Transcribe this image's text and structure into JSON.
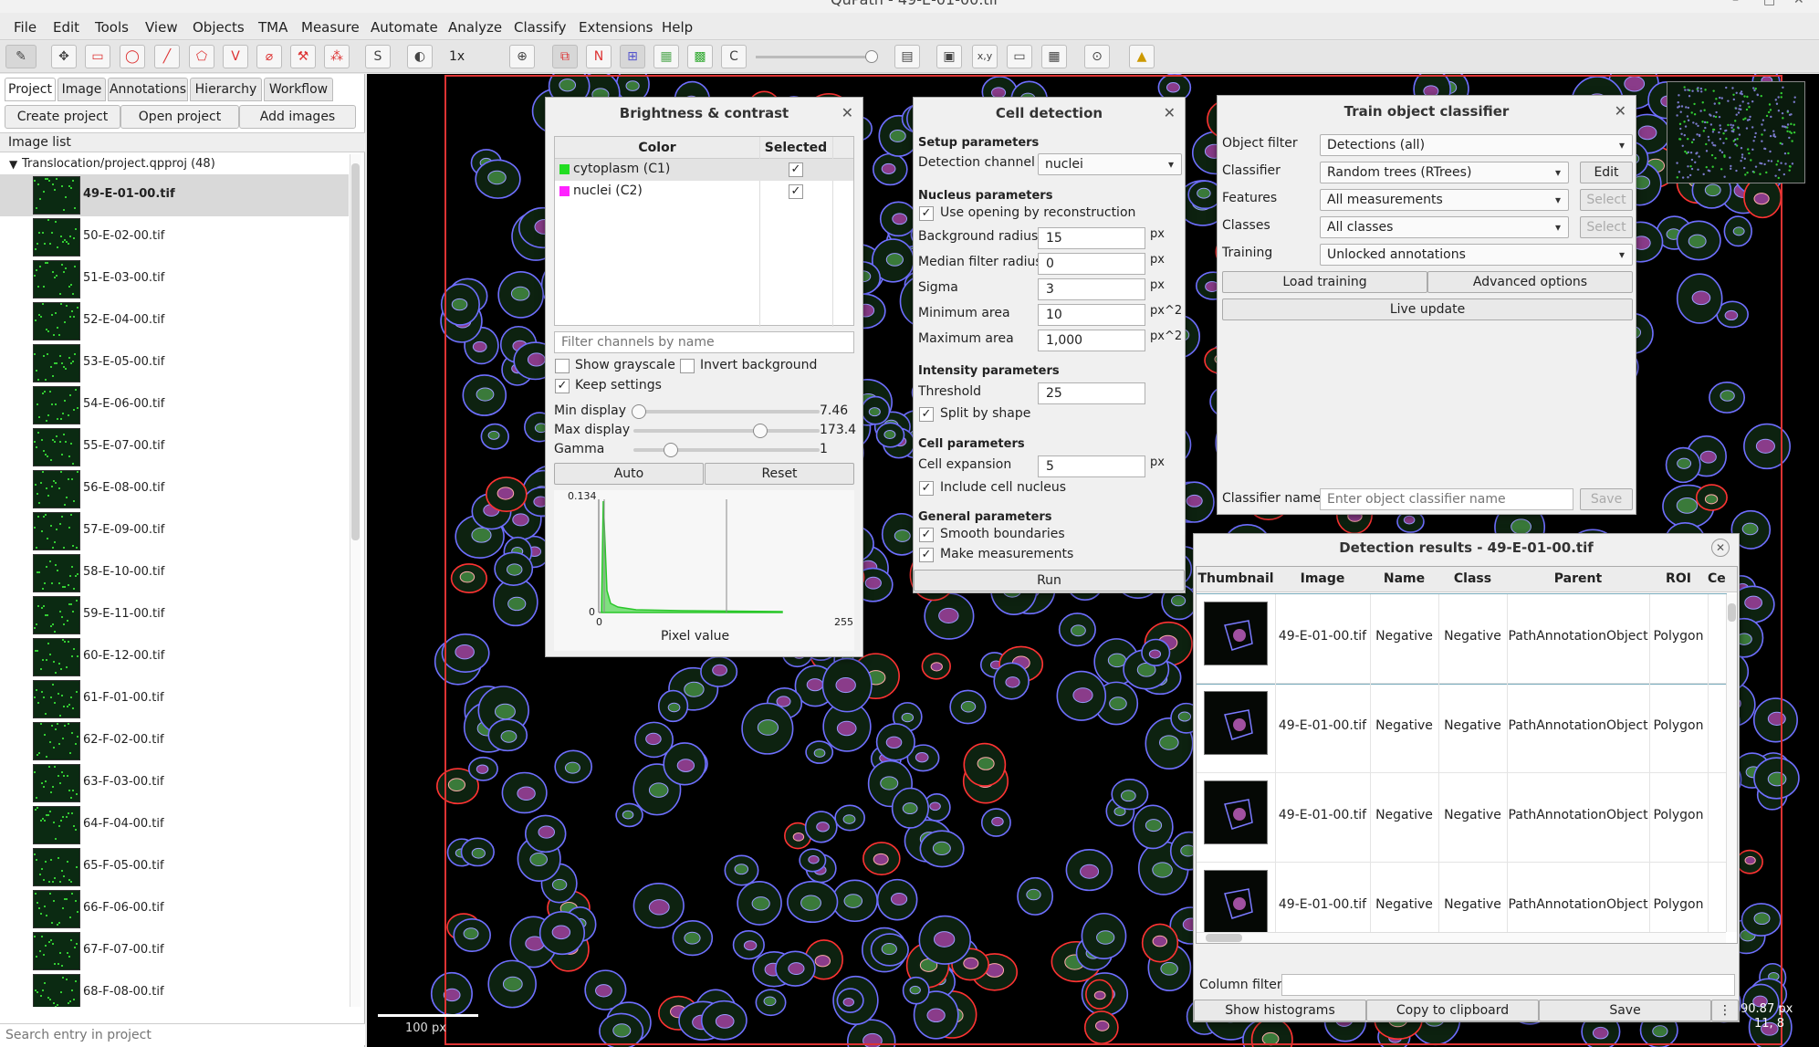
{
  "window_title": "QuPath - 49-E-01-00.tif",
  "menu": [
    "File",
    "Edit",
    "Tools",
    "View",
    "Objects",
    "TMA",
    "Measure",
    "Automate",
    "Analyze",
    "Classify",
    "Extensions",
    "Help"
  ],
  "toolbar": {
    "zoom_label": "1x",
    "s_label": "S",
    "n_label": "N",
    "c_label": "C",
    "xy_label": "x,y"
  },
  "left_panel": {
    "tabs": [
      "Project",
      "Image",
      "Annotations",
      "Hierarchy",
      "Workflow"
    ],
    "buttons": [
      "Create project",
      "Open project",
      "Add images"
    ],
    "image_list_header": "Image list",
    "project_node": "Translocation/project.qpproj (48)",
    "images": [
      "49-E-01-00.tif",
      "50-E-02-00.tif",
      "51-E-03-00.tif",
      "52-E-04-00.tif",
      "53-E-05-00.tif",
      "54-E-06-00.tif",
      "55-E-07-00.tif",
      "56-E-08-00.tif",
      "57-E-09-00.tif",
      "58-E-10-00.tif",
      "59-E-11-00.tif",
      "60-E-12-00.tif",
      "61-F-01-00.tif",
      "62-F-02-00.tif",
      "63-F-03-00.tif",
      "64-F-04-00.tif",
      "65-F-05-00.tif",
      "66-F-06-00.tif",
      "67-F-07-00.tif",
      "68-F-08-00.tif"
    ],
    "search_placeholder": "Search entry in project"
  },
  "viewer": {
    "scale_bar": "100 px",
    "coords_line1": "90.87 px",
    "coords_line2": "11, 8"
  },
  "brightness": {
    "title": "Brightness & contrast",
    "col_color": "Color",
    "col_selected": "Selected",
    "channels": [
      {
        "name": "cytoplasm (C1)",
        "swatch": "#22dd22",
        "selected": "✓"
      },
      {
        "name": "nuclei (C2)",
        "swatch": "#ff22ff",
        "selected": "✓"
      }
    ],
    "filter_placeholder": "Filter channels by name",
    "show_grayscale": "Show grayscale",
    "invert_background": "Invert background",
    "keep_settings": "Keep settings",
    "min_display_label": "Min display",
    "min_display_value": "7.46",
    "min_display_level": 0.03,
    "max_display_label": "Max display",
    "max_display_value": "173.4",
    "max_display_level": 0.68,
    "gamma_label": "Gamma",
    "gamma_value": "1",
    "gamma_level": 0.2,
    "auto": "Auto",
    "reset": "Reset",
    "histogram": {
      "ymax_label": "0.134",
      "y0_label": "0",
      "x0_label": "0",
      "xmax_label": "255",
      "xlabel": "Pixel value"
    }
  },
  "cell_detection": {
    "title": "Cell detection",
    "setup": "Setup parameters",
    "detection_channel_label": "Detection channel",
    "detection_channel_value": "nuclei",
    "nucleus": "Nucleus parameters",
    "use_opening": "Use opening by reconstruction",
    "bg_radius_label": "Background radius",
    "bg_radius": "15",
    "median_label": "Median filter radius",
    "median": "0",
    "sigma_label": "Sigma",
    "sigma": "3",
    "min_area_label": "Minimum area",
    "min_area": "10",
    "max_area_label": "Maximum area",
    "max_area": "1,000",
    "unit_px": "px",
    "unit_px2": "px^2",
    "intensity": "Intensity parameters",
    "threshold_label": "Threshold",
    "threshold": "25",
    "split_by_shape": "Split by shape",
    "cell": "Cell parameters",
    "cell_expansion_label": "Cell expansion",
    "cell_expansion": "5",
    "include_nucleus": "Include cell nucleus",
    "general": "General parameters",
    "smooth": "Smooth boundaries",
    "make_measurements": "Make measurements",
    "run": "Run"
  },
  "classifier": {
    "title": "Train object classifier",
    "object_filter_label": "Object filter",
    "object_filter": "Detections (all)",
    "classifier_label": "Classifier",
    "classifier": "Random trees (RTrees)",
    "edit": "Edit",
    "features_label": "Features",
    "features": "All measurements",
    "select": "Select",
    "classes_label": "Classes",
    "classes": "All classes",
    "training_label": "Training",
    "training": "Unlocked annotations",
    "load_training": "Load training",
    "advanced": "Advanced options",
    "live_update": "Live update",
    "name_label": "Classifier name",
    "name_placeholder": "Enter object classifier name",
    "save": "Save"
  },
  "results": {
    "title": "Detection results - 49-E-01-00.tif",
    "columns": [
      "Thumbnail",
      "Image",
      "Name",
      "Class",
      "Parent",
      "ROI",
      "Ce"
    ],
    "rows": [
      {
        "image": "49-E-01-00.tif",
        "name": "Negative",
        "class": "Negative",
        "parent": "PathAnnotationObject",
        "roi": "Polygon"
      },
      {
        "image": "49-E-01-00.tif",
        "name": "Negative",
        "class": "Negative",
        "parent": "PathAnnotationObject",
        "roi": "Polygon"
      },
      {
        "image": "49-E-01-00.tif",
        "name": "Negative",
        "class": "Negative",
        "parent": "PathAnnotationObject",
        "roi": "Polygon"
      },
      {
        "image": "49-E-01-00.tif",
        "name": "Negative",
        "class": "Negative",
        "parent": "PathAnnotationObject",
        "roi": "Polygon"
      }
    ],
    "column_filter_label": "Column filter",
    "show_histograms": "Show histograms",
    "copy": "Copy to clipboard",
    "save": "Save"
  },
  "colors": {
    "accent_red": "#dd3333",
    "cell_blue": "#6f6fff",
    "cell_red": "#ff3333",
    "cell_green": "#33cc33"
  }
}
